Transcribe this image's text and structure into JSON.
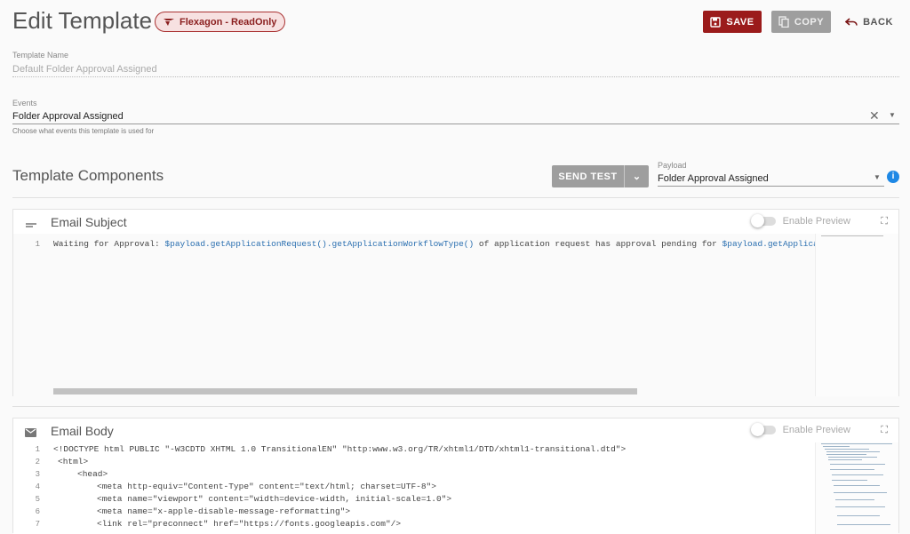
{
  "header": {
    "title": "Edit Template",
    "badge": "Flexagon - ReadOnly",
    "save_label": "SAVE",
    "copy_label": "COPY",
    "back_label": "BACK"
  },
  "template_name": {
    "label": "Template Name",
    "value": "Default Folder Approval Assigned"
  },
  "events": {
    "label": "Events",
    "value": "Folder Approval Assigned",
    "hint": "Choose what events this template is used for"
  },
  "components": {
    "title": "Template Components",
    "send_test_label": "SEND TEST",
    "payload_label": "Payload",
    "payload_value": "Folder Approval Assigned"
  },
  "email_subject": {
    "title": "Email Subject",
    "preview_label": "Enable Preview",
    "line_number": "1",
    "code_a": "Waiting for Approval: ",
    "code_b": "$payload.getApplicationRequest().getApplicationWorkflowType()",
    "code_c": " of application request has approval pending for ",
    "code_d": "$payload.getApplicationReq"
  },
  "email_body": {
    "title": "Email Body",
    "preview_label": "Enable Preview",
    "lines": [
      {
        "n": "1",
        "text": "<!DOCTYPE html PUBLIC \"-W3CDTD XHTML 1.0 TransitionalEN\" \"http:www.w3.org/TR/xhtml1/DTD/xhtml1-transitional.dtd\">"
      },
      {
        "n": "2",
        "text": "<html>"
      },
      {
        "n": "3",
        "text": "<head>"
      },
      {
        "n": "4",
        "text": "<meta http-equiv=\"Content-Type\" content=\"text/html; charset=UTF-8\">"
      },
      {
        "n": "5",
        "text": "<meta name=\"viewport\" content=\"width=device-width, initial-scale=1.0\">"
      },
      {
        "n": "6",
        "text": "<meta name=\"x-apple-disable-message-reformatting\">"
      },
      {
        "n": "7",
        "text": "<link rel=\"preconnect\" href=\"https://fonts.googleapis.com\"/>"
      }
    ]
  },
  "colors": {
    "brand": "#9b1b1b",
    "info": "#1e88e5"
  }
}
